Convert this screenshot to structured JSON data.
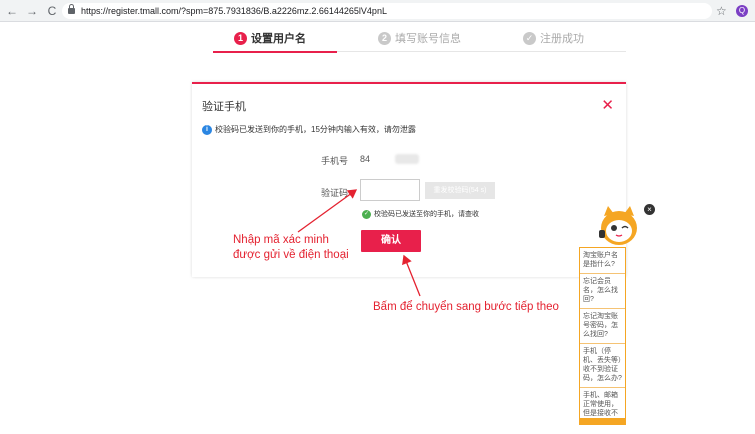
{
  "browser": {
    "back": "←",
    "forward": "→",
    "reload": "C",
    "url": "https://register.tmall.com/?spm=875.7931836/B.a2226mz.2.66144265lV4pnL",
    "star": "☆",
    "extension": "Q"
  },
  "steps": [
    {
      "num": "1",
      "label": "设置用户名"
    },
    {
      "num": "2",
      "label": "填写账号信息"
    },
    {
      "num": "✓",
      "label": "注册成功"
    }
  ],
  "dialog": {
    "title": "验证手机",
    "close": "✕",
    "info_icon": "i",
    "info_text": "校验码已发送到你的手机，15分钟内输入有效，请勿泄露",
    "phone_label": "手机号",
    "phone_value": "84",
    "code_label": "验证码",
    "code_placeholder": "",
    "resend_label": "重发校验码(54 s)",
    "sent_icon": "✓",
    "sent_text": "校验码已发送至你的手机，请查收",
    "confirm_label": "确认"
  },
  "annotations": {
    "enter_code_line1": "Nhập mã xác minh",
    "enter_code_line2": "được gửi về điện thoại",
    "click_next": "Bấm để chuyển sang bước tiếp theo"
  },
  "help_panel": {
    "close": "×",
    "items": [
      "淘宝账户名是指什么?",
      "忘记会员名，怎么找回?",
      "忘记淘宝账号密码，怎么找回?",
      "手机（停机、丢失等）收不到验证码，怎么办?",
      "手机、邮箱正常使用，但是接收不到验证码，怎么办?"
    ]
  },
  "colors": {
    "brand_red": "#e8204b",
    "annotation_red": "#e42230",
    "help_border": "#f5a623"
  }
}
